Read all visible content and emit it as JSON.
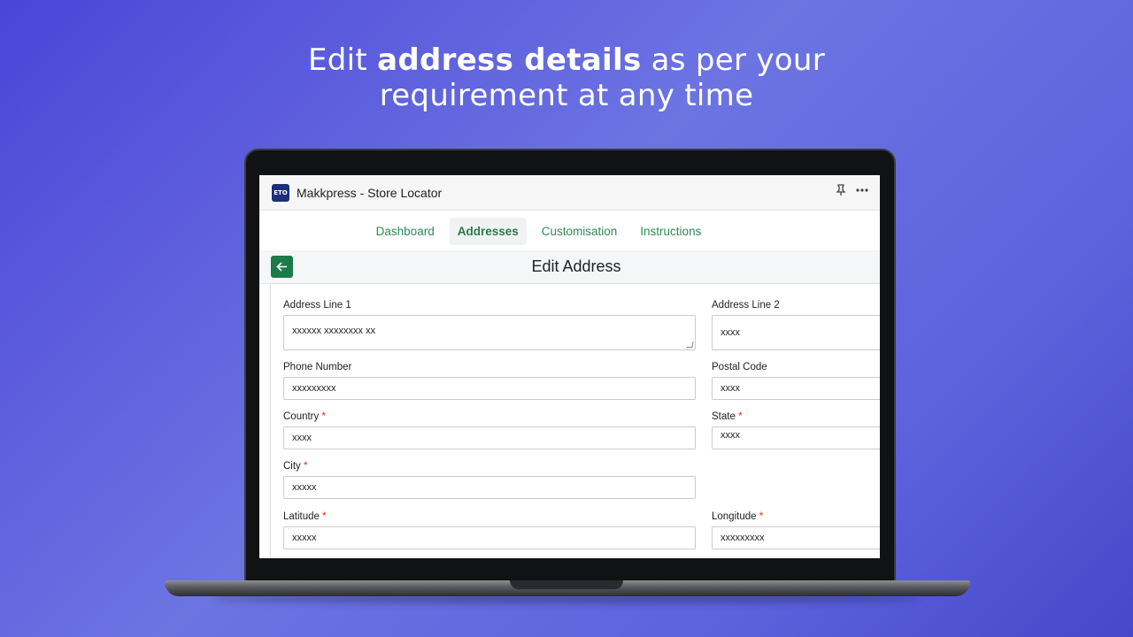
{
  "headline": {
    "prefix": "Edit ",
    "bold": "address details",
    "suffix": " as per your",
    "line2": "requirement at any time"
  },
  "app": {
    "logo_text": "ETO",
    "title": "Makkpress - Store Locator",
    "icons": [
      "pin-icon",
      "more-icon"
    ]
  },
  "nav": {
    "tabs": [
      {
        "label": "Dashboard",
        "active": false
      },
      {
        "label": "Addresses",
        "active": true
      },
      {
        "label": "Customisation",
        "active": false
      },
      {
        "label": "Instructions",
        "active": false
      }
    ]
  },
  "page": {
    "back_icon": "arrow-left-icon",
    "title": "Edit Address"
  },
  "form": {
    "address_line_1": {
      "label": "Address Line 1",
      "value": "xxxxxx xxxxxxxx xx"
    },
    "address_line_2": {
      "label": "Address Line 2",
      "value": "xxxx"
    },
    "phone_number": {
      "label": "Phone Number",
      "value": "xxxxxxxxx"
    },
    "postal_code": {
      "label": "Postal Code",
      "value": "xxxx"
    },
    "country": {
      "label": "Country",
      "required": "*",
      "value": "xxxx"
    },
    "state": {
      "label": "State",
      "required": "*",
      "value": "xxxx"
    },
    "city": {
      "label": "City",
      "required": "*",
      "value": "xxxxx"
    },
    "latitude": {
      "label": "Latitude",
      "required": "*",
      "value": "xxxxx"
    },
    "longitude": {
      "label": "Longitude",
      "required": "*",
      "value": "xxxxxxxxx"
    }
  },
  "colors": {
    "accent": "#1d7a4a",
    "tab_text": "#2e8b57",
    "required": "#d72c0d"
  }
}
